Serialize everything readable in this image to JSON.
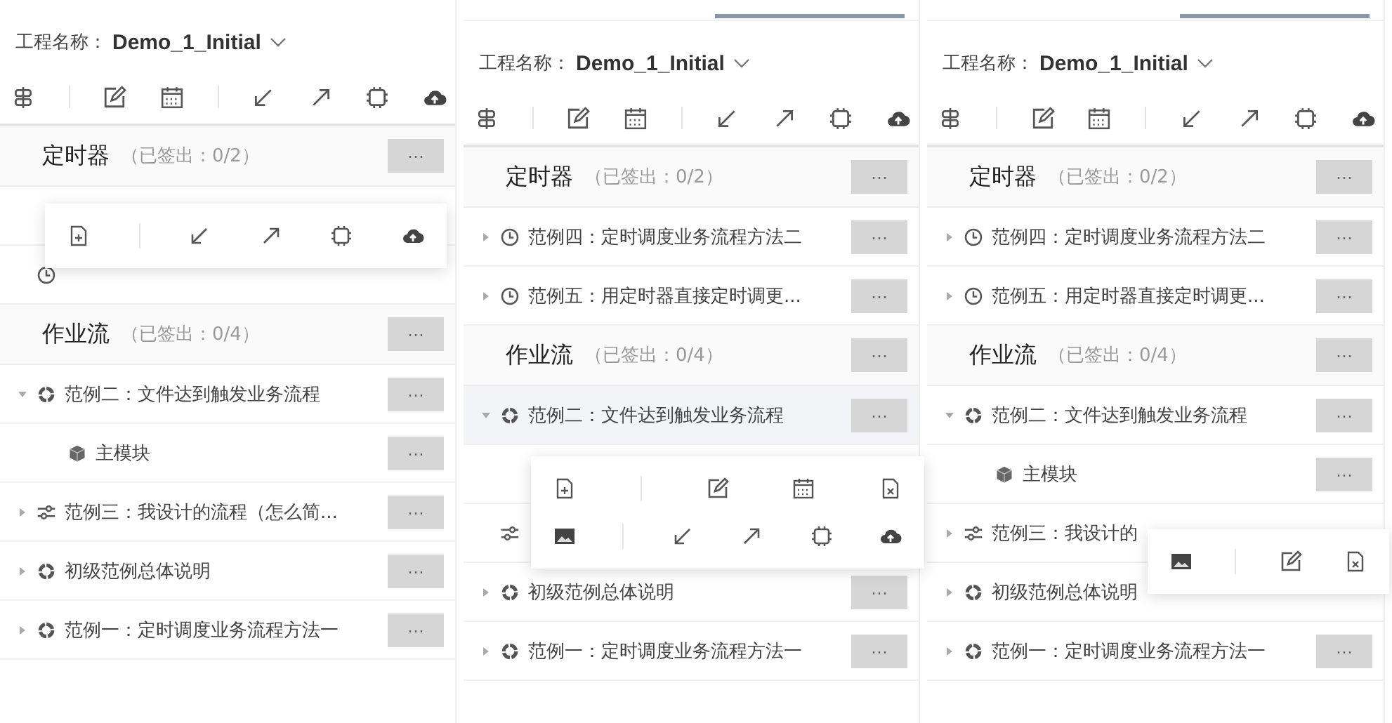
{
  "panels": [
    {
      "tab_indicator": false,
      "project_label": "工程名称：",
      "project_name": "Demo_1_Initial",
      "toolbar": [
        {
          "kind": "signpost"
        },
        {
          "kind": "separator"
        },
        {
          "kind": "edit"
        },
        {
          "kind": "calendar"
        },
        {
          "kind": "separator"
        },
        {
          "kind": "import"
        },
        {
          "kind": "export"
        },
        {
          "kind": "chip"
        },
        {
          "kind": "cloud"
        }
      ],
      "sections": [
        {
          "title": "定时器",
          "status": "（已签出：0/2）",
          "more": "···",
          "rows": [
            {
              "covered": true,
              "popup": [
                [
                  {
                    "kind": "new-file"
                  },
                  {
                    "kind": "separator"
                  },
                  {
                    "kind": "import"
                  },
                  {
                    "kind": "export"
                  },
                  {
                    "kind": "chip"
                  },
                  {
                    "kind": "cloud"
                  }
                ]
              ]
            },
            {
              "covered": true,
              "kind": "clock"
            }
          ]
        },
        {
          "title": "作业流",
          "status": "（已签出：0/4）",
          "more": "···",
          "rows": [
            {
              "kind": "ring",
              "label": "范例二：文件达到触发业务流程",
              "expanded": true,
              "selected": false,
              "more": "···",
              "children": [
                {
                  "kind": "cube",
                  "label": "主模块",
                  "selected": false,
                  "more": "···"
                }
              ]
            },
            {
              "kind": "sliders",
              "label": "范例三：我设计的流程（怎么简...",
              "expanded": false,
              "selected": false,
              "more": "···"
            },
            {
              "kind": "ring",
              "label": "初级范例总体说明",
              "expanded": false,
              "selected": false,
              "more": "···"
            },
            {
              "kind": "ring",
              "label": "范例一：定时调度业务流程方法一",
              "expanded": false,
              "selected": false,
              "more": "···"
            }
          ]
        }
      ]
    },
    {
      "tab_indicator": true,
      "project_label": "工程名称：",
      "project_name": "Demo_1_Initial",
      "toolbar": [
        {
          "kind": "signpost"
        },
        {
          "kind": "separator"
        },
        {
          "kind": "edit"
        },
        {
          "kind": "calendar"
        },
        {
          "kind": "separator"
        },
        {
          "kind": "import"
        },
        {
          "kind": "export"
        },
        {
          "kind": "chip"
        },
        {
          "kind": "cloud"
        }
      ],
      "sections": [
        {
          "title": "定时器",
          "status": "（已签出：0/2）",
          "more": "···",
          "rows": [
            {
              "kind": "clock",
              "label": "范例四：定时调度业务流程方法二",
              "expanded": false,
              "selected": false,
              "more": "···"
            },
            {
              "kind": "clock",
              "label": "范例五：用定时器直接定时调更...",
              "expanded": false,
              "selected": false,
              "more": "···"
            }
          ]
        },
        {
          "title": "作业流",
          "status": "（已签出：0/4）",
          "more": "···",
          "rows": [
            {
              "kind": "ring",
              "label": "范例二：文件达到触发业务流程",
              "expanded": true,
              "selected": true,
              "more": "···",
              "children": [
                {
                  "covered": true,
                  "popup": [
                    [
                      {
                        "kind": "new-file"
                      },
                      {
                        "kind": "separator"
                      },
                      {
                        "kind": "edit"
                      },
                      {
                        "kind": "calendar"
                      },
                      {
                        "kind": "delete-file"
                      }
                    ],
                    [
                      {
                        "kind": "image"
                      },
                      {
                        "kind": "separator"
                      },
                      {
                        "kind": "import"
                      },
                      {
                        "kind": "export"
                      },
                      {
                        "kind": "chip"
                      },
                      {
                        "kind": "cloud"
                      }
                    ]
                  ]
                }
              ]
            },
            {
              "covered": true,
              "kind": "sliders"
            },
            {
              "kind": "ring",
              "label": "初级范例总体说明",
              "expanded": false,
              "selected": false,
              "more": "···"
            },
            {
              "kind": "ring",
              "label": "范例一：定时调度业务流程方法一",
              "expanded": false,
              "selected": false,
              "more": "···"
            }
          ]
        }
      ]
    },
    {
      "tab_indicator": true,
      "project_label": "工程名称：",
      "project_name": "Demo_1_Initial",
      "toolbar": [
        {
          "kind": "signpost"
        },
        {
          "kind": "separator"
        },
        {
          "kind": "edit"
        },
        {
          "kind": "calendar"
        },
        {
          "kind": "separator"
        },
        {
          "kind": "import"
        },
        {
          "kind": "export"
        },
        {
          "kind": "chip"
        },
        {
          "kind": "cloud"
        }
      ],
      "sections": [
        {
          "title": "定时器",
          "status": "（已签出：0/2）",
          "more": "···",
          "rows": [
            {
              "kind": "clock",
              "label": "范例四：定时调度业务流程方法二",
              "expanded": false,
              "selected": false,
              "more": "···"
            },
            {
              "kind": "clock",
              "label": "范例五：用定时器直接定时调更...",
              "expanded": false,
              "selected": false,
              "more": "···"
            }
          ]
        },
        {
          "title": "作业流",
          "status": "（已签出：0/4）",
          "more": "···",
          "rows": [
            {
              "kind": "ring",
              "label": "范例二：文件达到触发业务流程",
              "expanded": true,
              "selected": false,
              "more": "···",
              "children": [
                {
                  "kind": "cube",
                  "label": "主模块",
                  "selected": false,
                  "more": "···"
                }
              ]
            },
            {
              "kind": "sliders",
              "label": "范例三：我设计的",
              "expanded": false,
              "selected": false,
              "popup": [
                [
                  {
                    "kind": "image"
                  },
                  {
                    "kind": "separator"
                  },
                  {
                    "kind": "edit"
                  },
                  {
                    "kind": "delete-file"
                  }
                ]
              ]
            },
            {
              "kind": "ring",
              "label": "初级范例总体说明",
              "expanded": false,
              "selected": false
            },
            {
              "kind": "ring",
              "label": "范例一：定时调度业务流程方法一",
              "expanded": false,
              "selected": false,
              "more": "···"
            }
          ]
        }
      ]
    }
  ]
}
